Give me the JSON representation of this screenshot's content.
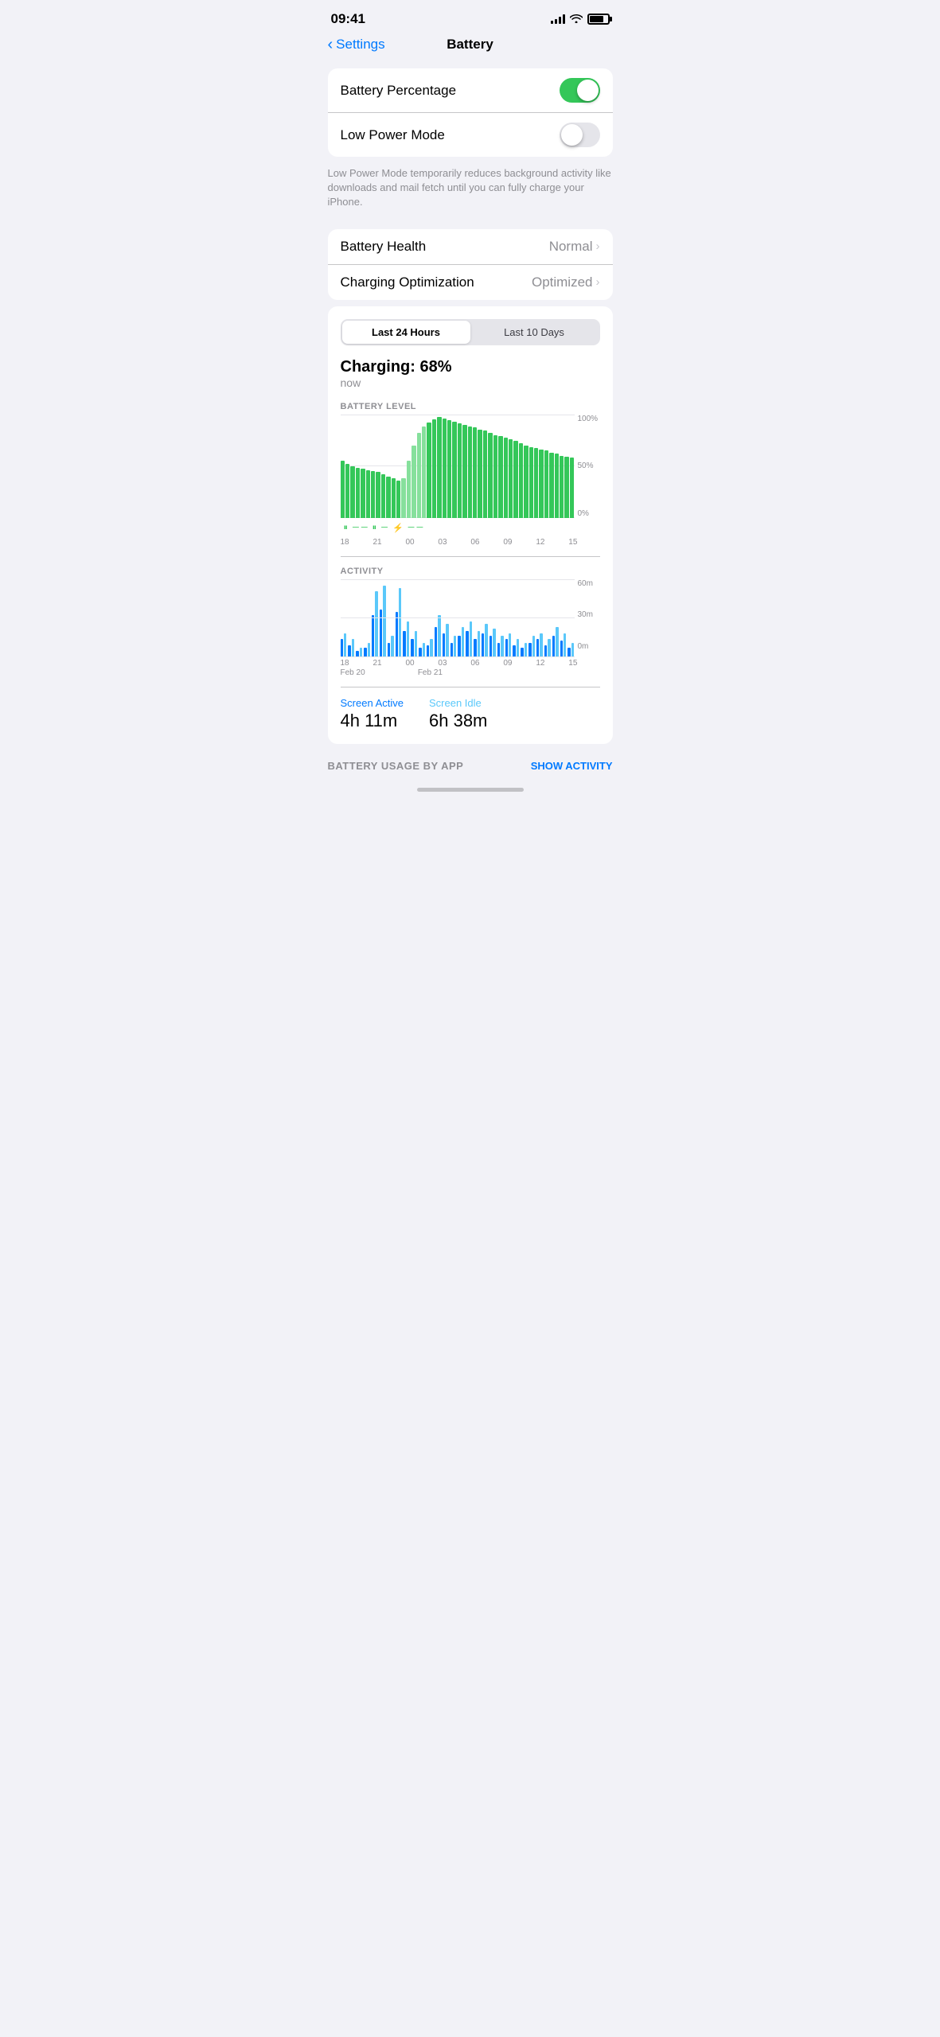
{
  "status_bar": {
    "time": "09:41"
  },
  "nav": {
    "back_label": "Settings",
    "title": "Battery"
  },
  "settings": {
    "battery_percentage_label": "Battery Percentage",
    "battery_percentage_on": true,
    "low_power_mode_label": "Low Power Mode",
    "low_power_mode_on": false,
    "low_power_note": "Low Power Mode temporarily reduces background activity like downloads and mail fetch until you can fully charge your iPhone.",
    "battery_health_label": "Battery Health",
    "battery_health_value": "Normal",
    "charging_optimization_label": "Charging Optimization",
    "charging_optimization_value": "Optimized"
  },
  "chart": {
    "tab_24h": "Last 24 Hours",
    "tab_10d": "Last 10 Days",
    "active_tab": "24h",
    "charging_status": "Charging: 68%",
    "charging_time": "now",
    "battery_level_label": "BATTERY LEVEL",
    "y_labels": [
      "100%",
      "50%",
      "0%"
    ],
    "x_labels": [
      "18",
      "21",
      "00",
      "03",
      "06",
      "09",
      "12",
      "15"
    ],
    "activity_label": "ACTIVITY",
    "activity_y_labels": [
      "60m",
      "30m",
      "0m"
    ],
    "activity_x_labels": [
      "18",
      "21",
      "00",
      "03",
      "06",
      "09",
      "12",
      "15"
    ],
    "date_labels_1": [
      "Feb 20",
      "",
      "",
      "Feb 21",
      "",
      "",
      "",
      ""
    ],
    "screen_active_label": "Screen Active",
    "screen_active_value": "4h 11m",
    "screen_idle_label": "Screen Idle",
    "screen_idle_value": "6h 38m",
    "bottom_usage_label": "BATTERY USAGE BY APP",
    "bottom_action": "SHOW ACTIVITY"
  }
}
